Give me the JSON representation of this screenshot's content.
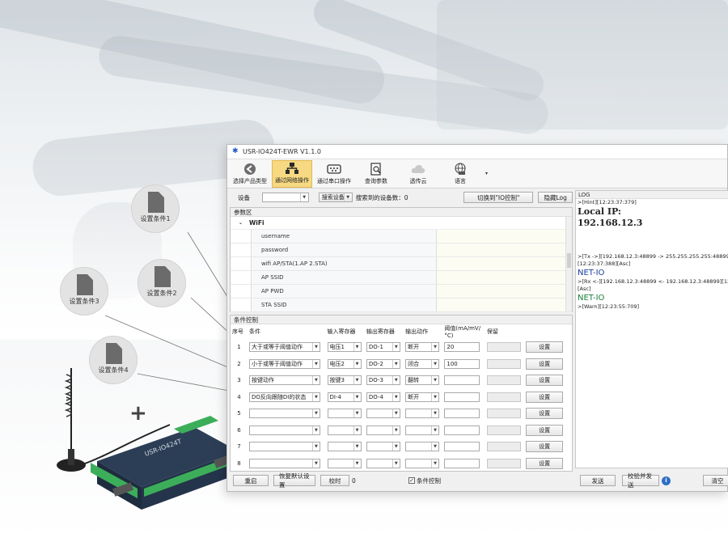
{
  "window": {
    "title": "USR-IO424T-EWR V1.1.0"
  },
  "toolbar": {
    "items": [
      {
        "label": "选择产品类型",
        "icon": "back-arrow-icon",
        "active": false
      },
      {
        "label": "通过网络操作",
        "icon": "network-icon",
        "active": true
      },
      {
        "label": "通过串口操作",
        "icon": "serial-port-icon",
        "active": false
      },
      {
        "label": "查询参数",
        "icon": "query-doc-icon",
        "active": false
      },
      {
        "label": "透传云",
        "icon": "cloud-icon",
        "active": false
      },
      {
        "label": "语言",
        "icon": "language-globe-icon",
        "active": false
      }
    ],
    "more": "▾"
  },
  "device": {
    "label": "设备",
    "search_btn": "搜索设备",
    "found_label": "搜索到的设备数：0",
    "switch_btn": "切换到\"IO控制\"",
    "hide_log_btn": "隐藏Log"
  },
  "params": {
    "title": "参数区",
    "group": "WiFi",
    "rows": [
      "username",
      "password",
      "wifi AP/STA(1.AP 2.STA)",
      "AP SSID",
      "AP PWD",
      "STA SSID"
    ]
  },
  "conditions": {
    "title": "条件控制",
    "headers": [
      "序号",
      "条件",
      "输入寄存器",
      "输出寄存器",
      "输出动作",
      "阈值(mA/mV/°C)",
      "保留",
      ""
    ],
    "rows": [
      {
        "no": "1",
        "cond": "大于或等于阈值动作",
        "in": "电压1",
        "out": "DO-1",
        "act": "断开",
        "thr": "20",
        "btn": "设置"
      },
      {
        "no": "2",
        "cond": "小于或等于阈值动作",
        "in": "电压2",
        "out": "DO-2",
        "act": "闭合",
        "thr": "100",
        "btn": "设置"
      },
      {
        "no": "3",
        "cond": "按键动作",
        "in": "按键3",
        "out": "DO-3",
        "act": "翻转",
        "thr": "",
        "btn": "设置"
      },
      {
        "no": "4",
        "cond": "DO反向跟随DI的状态",
        "in": "DI-4",
        "out": "DO-4",
        "act": "断开",
        "thr": "",
        "btn": "设置"
      },
      {
        "no": "5",
        "cond": "",
        "in": "",
        "out": "",
        "act": "",
        "thr": "",
        "btn": "设置"
      },
      {
        "no": "6",
        "cond": "",
        "in": "",
        "out": "",
        "act": "",
        "thr": "",
        "btn": "设置"
      },
      {
        "no": "7",
        "cond": "",
        "in": "",
        "out": "",
        "act": "",
        "thr": "",
        "btn": "设置"
      },
      {
        "no": "8",
        "cond": "",
        "in": "",
        "out": "",
        "act": "",
        "thr": "",
        "btn": "设置"
      }
    ]
  },
  "bottom": {
    "restart": "重启",
    "restore": "恢复默认设置",
    "calib": "校时",
    "calib_value": "0",
    "cond_ctrl_check": "✓",
    "cond_ctrl_label": "条件控制"
  },
  "log": {
    "title": "LOG",
    "hint": ">[Hint][12:23:37:379]",
    "local_ip_label": "Local IP:",
    "local_ip": "192.168.12.3",
    "tx": ">[Tx ->][192.168.12.3:48899 -> 255.255.255.255:48899]",
    "tx2": "[12:23:37:388][Asc]",
    "net1": "NET-IO",
    "rx": ">[Rx <-][192.168.12.3:48899 <- 192.168.12.3:48899][12:23:3",
    "rx2": "[Asc]",
    "net2": "NET-IO",
    "warn": ">[Warn][12:23:55:709]",
    "send_btn": "发送",
    "check_send_btn": "校验并发送",
    "clear_btn": "清空"
  },
  "callouts": [
    "设置条件1",
    "设置条件2",
    "设置条件3",
    "设置条件4"
  ],
  "plus": "+",
  "device_label": "USR-IO424T"
}
